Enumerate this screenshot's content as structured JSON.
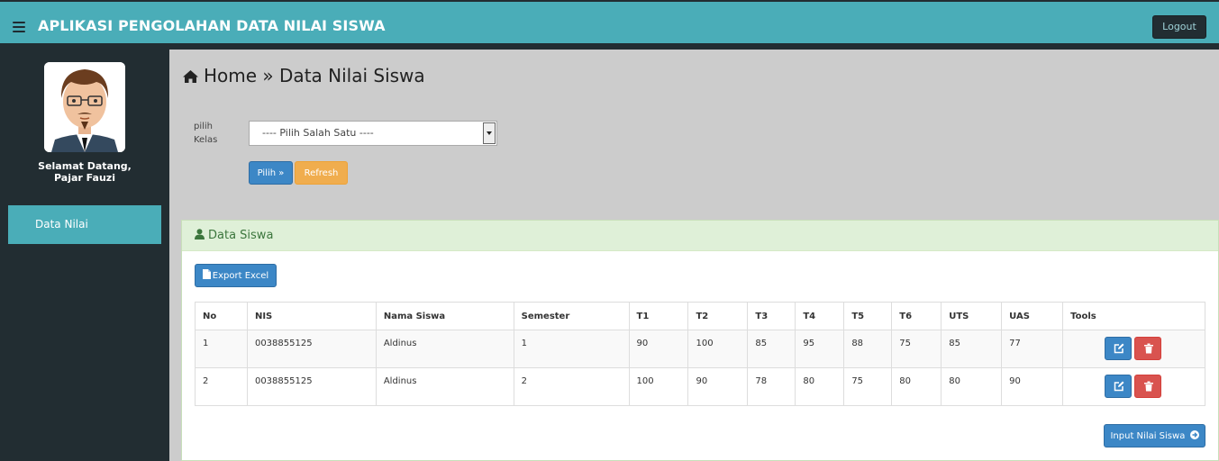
{
  "header": {
    "app_title": "APLIKASI PENGOLAHAN DATA NILAI SISWA",
    "logout_label": "Logout"
  },
  "sidebar": {
    "welcome_line1": "Selamat Datang,",
    "welcome_line2": "Pajar Fauzi",
    "items": [
      {
        "label": "Data Nilai"
      }
    ]
  },
  "breadcrumb": {
    "home": "Home",
    "separator": "»",
    "current": "Data Nilai Siswa"
  },
  "filter": {
    "label_line1": "pilih",
    "label_line2": "Kelas",
    "select_value": "---- Pilih Salah Satu ----",
    "pilih_label": "Pilih »",
    "refresh_label": "Refresh"
  },
  "panel": {
    "title": "Data Siswa",
    "export_label": "Export Excel",
    "input_label": "Input Nilai Siswa"
  },
  "table": {
    "headers": [
      "No",
      "NIS",
      "Nama Siswa",
      "Semester",
      "T1",
      "T2",
      "T3",
      "T4",
      "T5",
      "T6",
      "UTS",
      "UAS",
      "Tools"
    ],
    "rows": [
      [
        "1",
        "0038855125",
        "Aldinus",
        "1",
        "90",
        "100",
        "85",
        "95",
        "88",
        "75",
        "85",
        "77"
      ],
      [
        "2",
        "0038855125",
        "Aldinus",
        "2",
        "100",
        "90",
        "78",
        "80",
        "75",
        "80",
        "80",
        "90"
      ]
    ]
  },
  "icons": {
    "menu": "hamburger-icon",
    "home": "home-icon",
    "user": "user-icon",
    "file": "file-icon",
    "edit": "edit-icon",
    "delete": "trash-icon",
    "arrow": "arrow-circle-right-icon"
  },
  "colors": {
    "topbar": "#4aadb8",
    "sidebar": "#222d32",
    "primary": "#3c87c6",
    "warning": "#f0ad4e",
    "danger": "#d9534f",
    "panel_heading": "#dff0d8"
  }
}
